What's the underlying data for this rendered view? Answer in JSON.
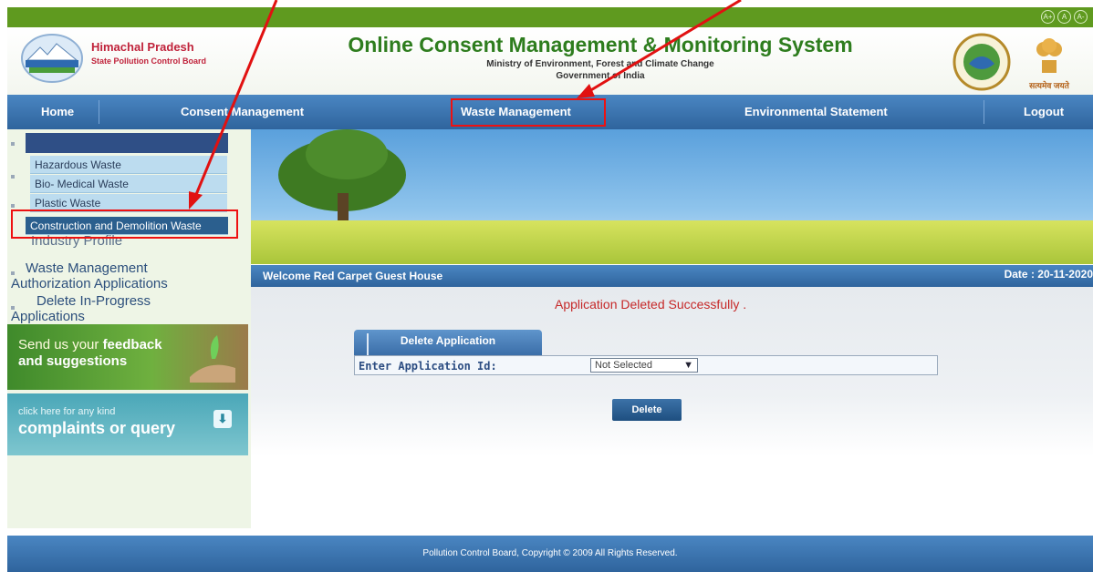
{
  "font_controls": [
    "A+",
    "A",
    "A-"
  ],
  "header": {
    "board_line1": "Himachal Pradesh",
    "board_line2": "State Pollution Control Board",
    "system_title": "Online Consent Management & Monitoring System",
    "ministry": "Ministry of Environment, Forest and Climate Change",
    "government": "Government of India",
    "emblem_caption": "सत्यमेव जयते"
  },
  "nav": {
    "home": "Home",
    "consent": "Consent Management",
    "waste": "Waste Management",
    "environment": "Environmental Statement",
    "logout": "Logout"
  },
  "dropdown": {
    "items": [
      "Hazardous Waste",
      "Bio- Medical Waste",
      "Plastic  Waste",
      "Construction and Demolition Waste"
    ]
  },
  "sidebar": {
    "industry_profile": "Industry Profile",
    "waste_auth_line1": "Waste Management",
    "waste_auth_line2": "Authorization Applications",
    "delete_line1": "Delete In-Progress",
    "delete_line2": "Applications",
    "feedback_line1_a": "Send us your ",
    "feedback_line1_b": "feedback",
    "feedback_line2": "and suggestions",
    "complaint_line1": "click here for any kind",
    "complaint_line2": "complaints or query"
  },
  "welcome": {
    "text": "Welcome Red Carpet Guest House",
    "date": "Date : 20-11-2020"
  },
  "main": {
    "message": "Application Deleted Successfully .",
    "tab_label": "Delete Application",
    "field_label": "Enter Application Id:",
    "select_value": "Not Selected",
    "delete_button": "Delete"
  },
  "footer": {
    "text": "Pollution Control Board, Copyright © 2009 All Rights Reserved."
  },
  "colors": {
    "annotation": "#e11111",
    "nav_blue": "#2f649d",
    "title_green": "#2e7d1e",
    "board_red": "#c0233b"
  }
}
